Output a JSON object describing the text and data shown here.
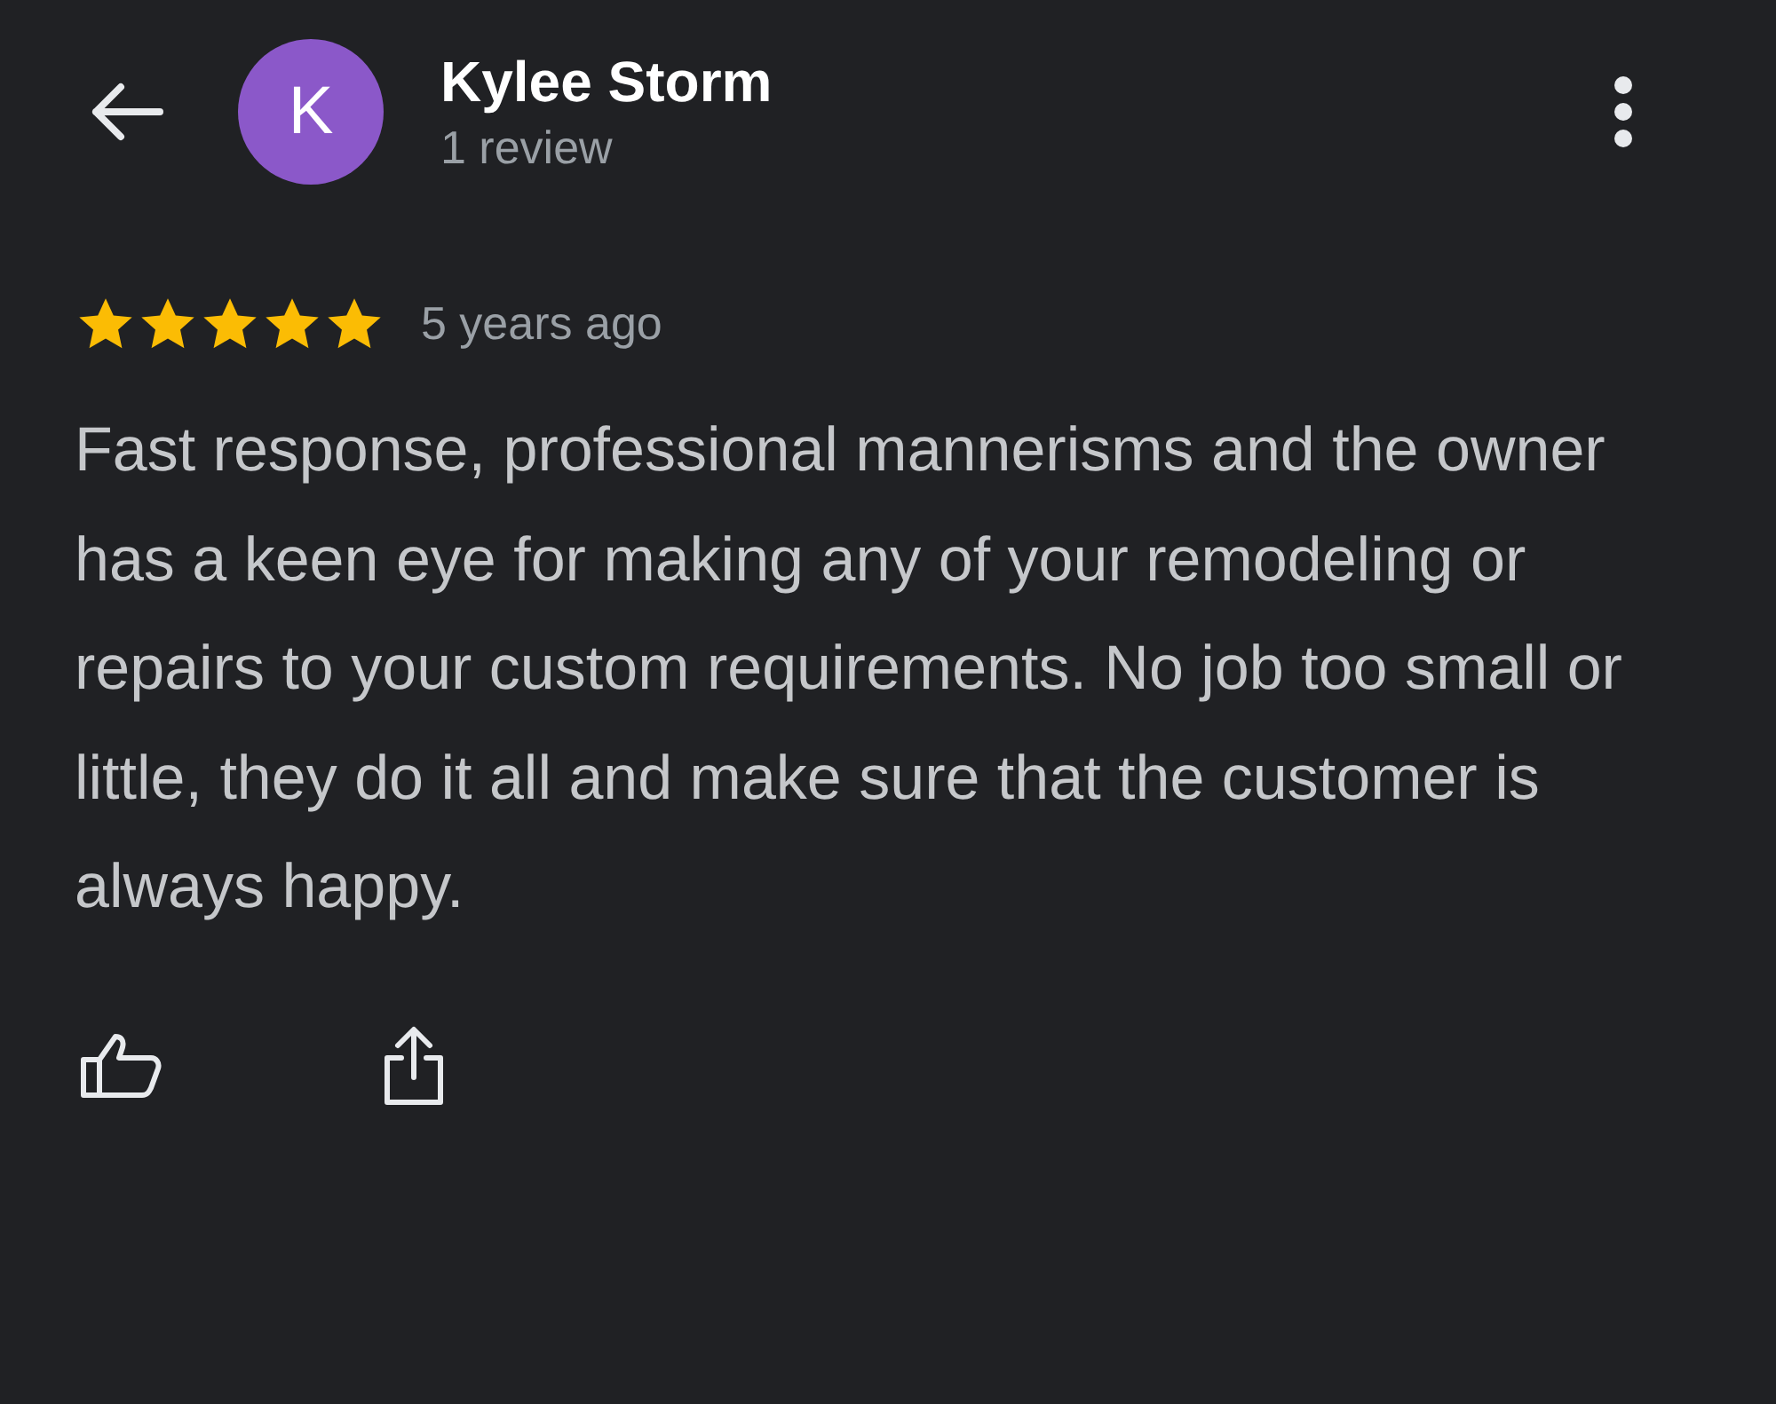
{
  "header": {
    "avatar_letter": "K",
    "name": "Kylee Storm",
    "subtitle": "1 review"
  },
  "review": {
    "stars": 5,
    "time": "5 years ago",
    "text": "Fast response, professional mannerisms and the owner has a keen eye for making any of your remodeling or repairs to your custom requirements. No job too small or little, they do it all and make sure that the customer is always happy."
  }
}
